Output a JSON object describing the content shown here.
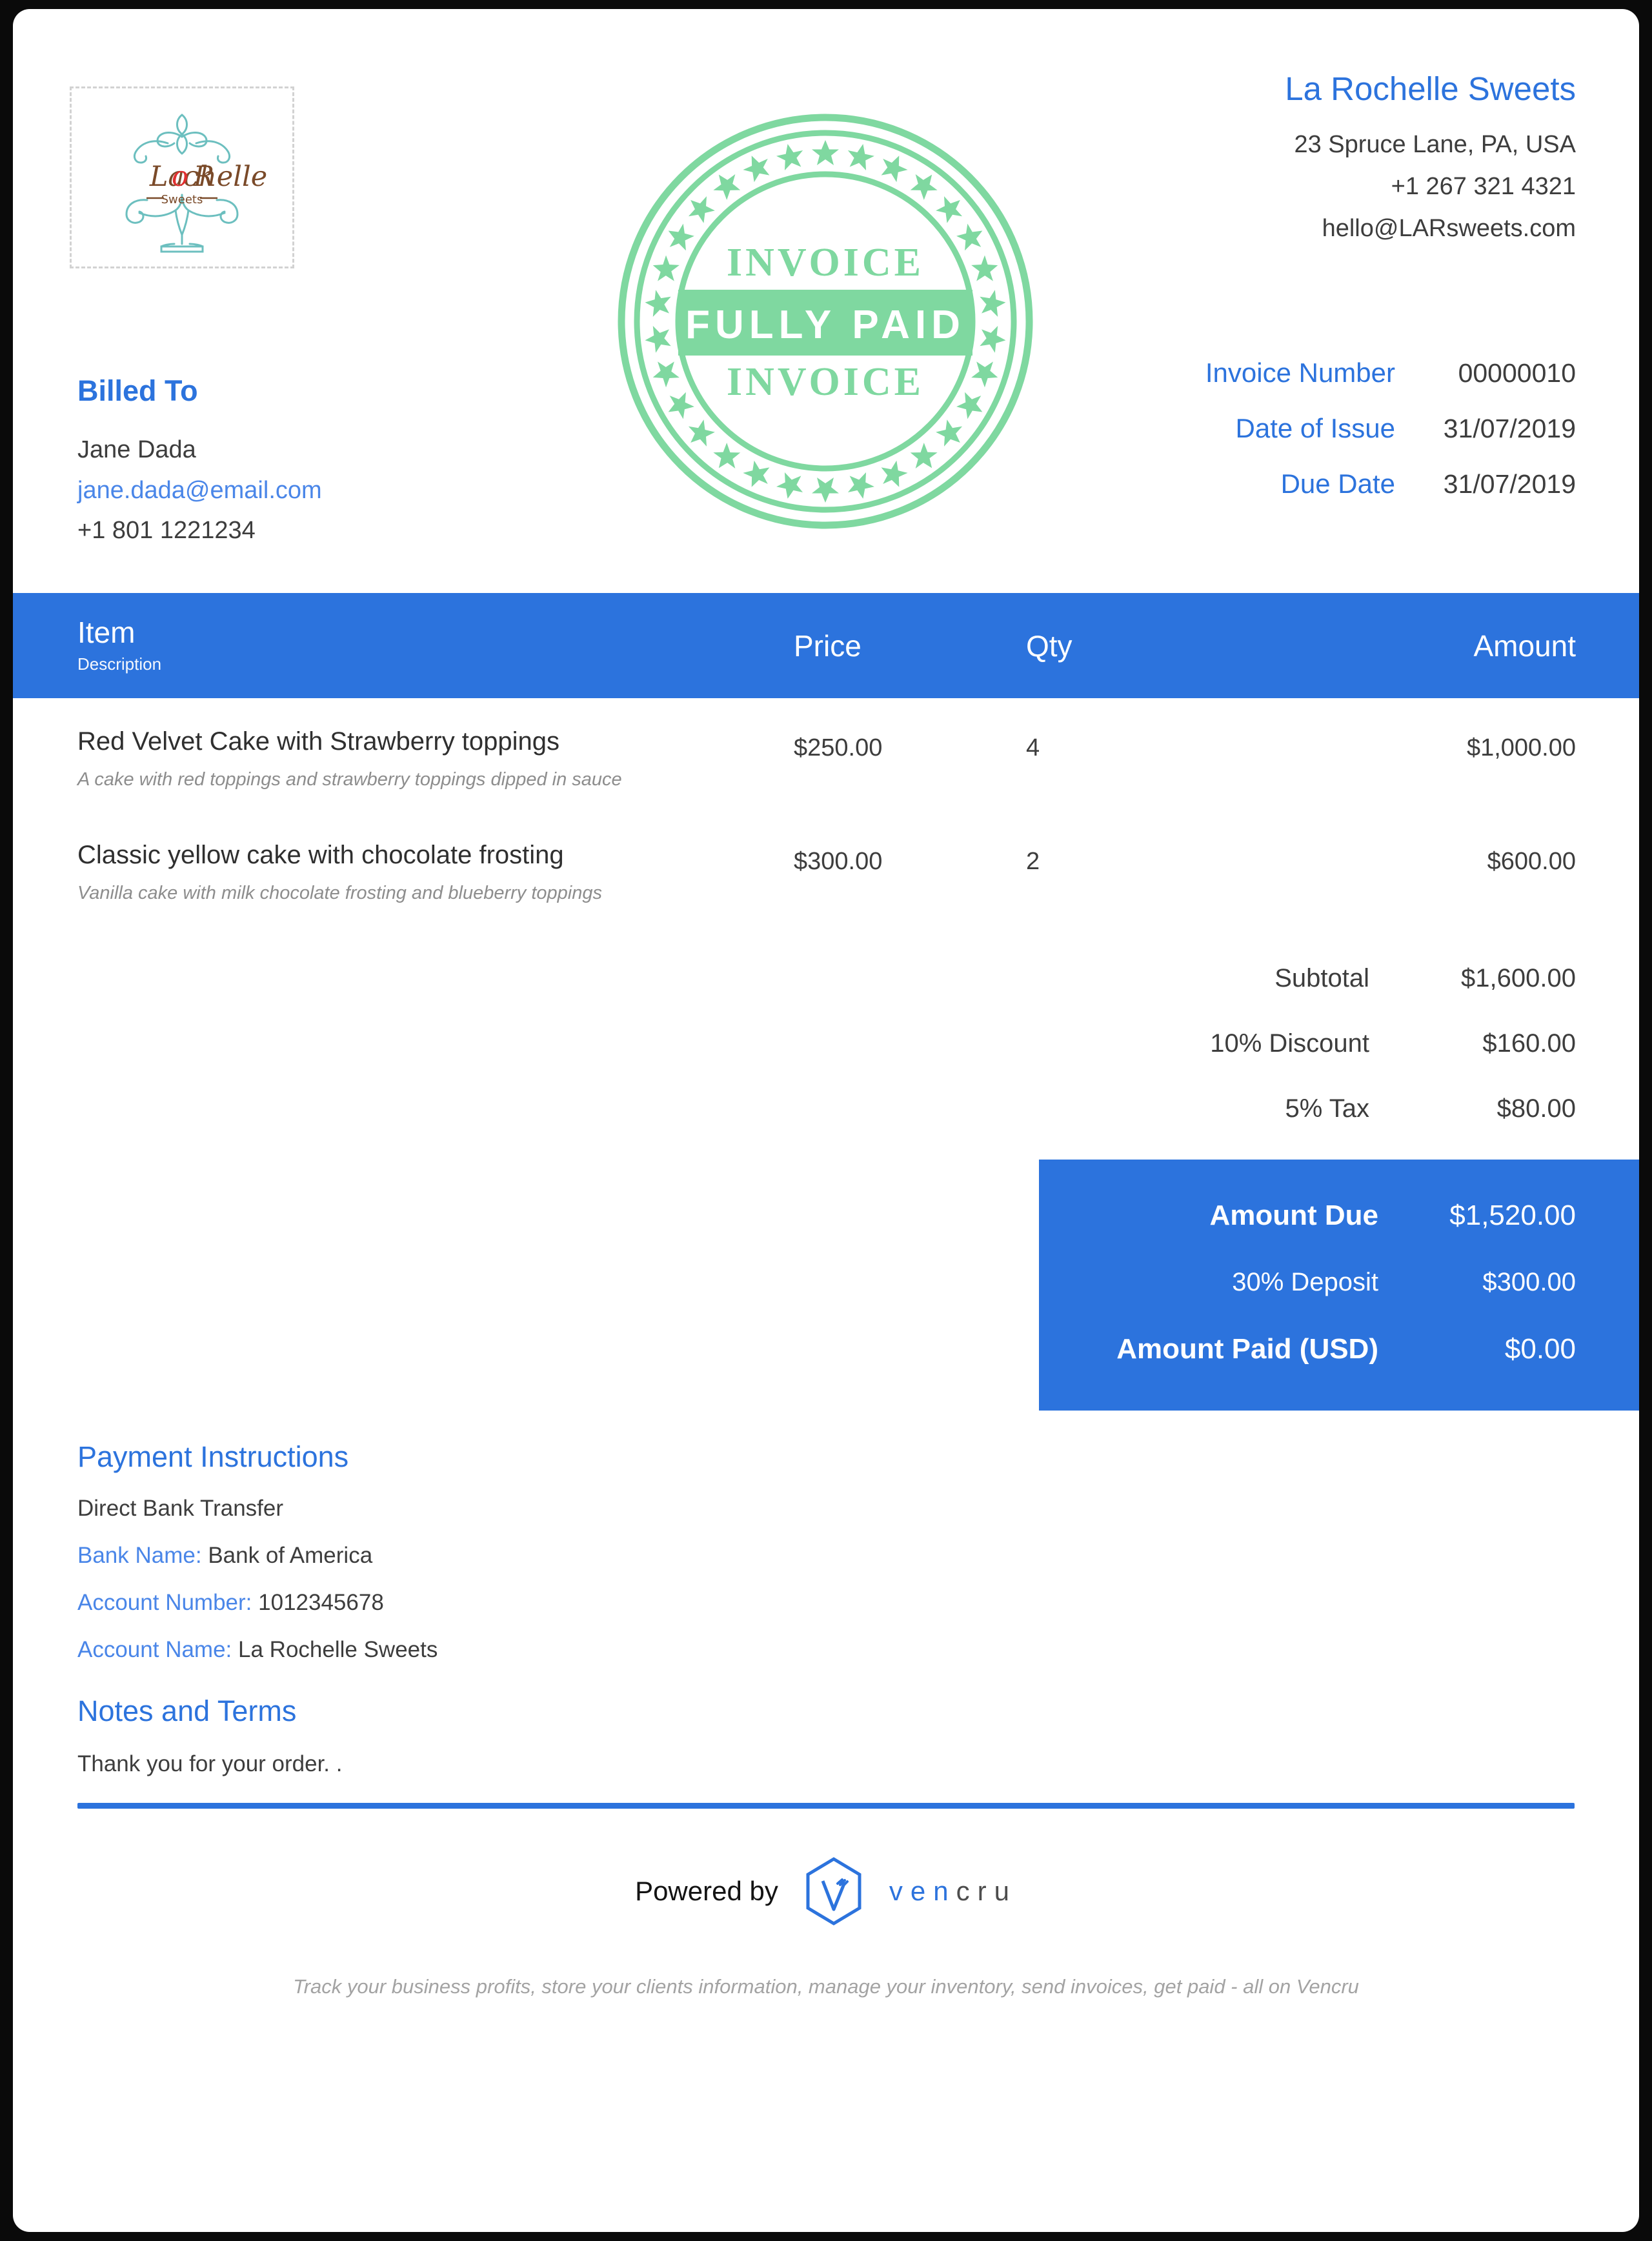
{
  "stamp": {
    "top_text": "INVOICE",
    "main_text": "FULLY PAID",
    "bottom_text": "INVOICE",
    "color": "#7fd8a0"
  },
  "logo": {
    "brand_script": "La Rochelle",
    "brand_sub": "Sweets"
  },
  "company": {
    "name": "La Rochelle Sweets",
    "address": "23 Spruce Lane, PA, USA",
    "phone": "+1 267 321 4321",
    "email": "hello@LARsweets.com"
  },
  "meta": {
    "rows": [
      {
        "label": "Invoice Number",
        "value": "00000010"
      },
      {
        "label": "Date of Issue",
        "value": "31/07/2019"
      },
      {
        "label": "Due Date",
        "value": "31/07/2019"
      }
    ]
  },
  "billed_to": {
    "title": "Billed To",
    "name": "Jane Dada",
    "email": "jane.dada@email.com",
    "phone": "+1 801 1221234"
  },
  "table": {
    "headers": {
      "item": "Item",
      "description": "Description",
      "price": "Price",
      "qty": "Qty",
      "amount": "Amount"
    },
    "rows": [
      {
        "name": "Red Velvet Cake with Strawberry toppings",
        "description": "A cake with red toppings and strawberry toppings dipped in sauce",
        "price": "$250.00",
        "qty": "4",
        "amount": "$1,000.00"
      },
      {
        "name": "Classic yellow cake with chocolate frosting",
        "description": "Vanilla cake with milk chocolate frosting and blueberry toppings",
        "price": "$300.00",
        "qty": "2",
        "amount": "$600.00"
      }
    ]
  },
  "totals": [
    {
      "label": "Subtotal",
      "value": "$1,600.00"
    },
    {
      "label": "10% Discount",
      "value": "$160.00"
    },
    {
      "label": "5% Tax",
      "value": "$80.00"
    }
  ],
  "due_box": {
    "amount_due_label": "Amount Due",
    "amount_due_value": "$1,520.00",
    "deposit_label": "30% Deposit",
    "deposit_value": "$300.00",
    "amount_paid_label": "Amount Paid (USD)",
    "amount_paid_value": "$0.00"
  },
  "payment": {
    "title": "Payment Instructions",
    "method": "Direct Bank Transfer",
    "bank_name_key": "Bank Name:",
    "bank_name_value": "Bank of America",
    "account_number_key": "Account Number:",
    "account_number_value": "1012345678",
    "account_name_key": "Account Name:",
    "account_name_value": "La Rochelle Sweets"
  },
  "notes": {
    "title": "Notes and Terms",
    "text": "Thank you for your order. ."
  },
  "footer": {
    "powered_by": "Powered by",
    "brand_part1": "ven",
    "brand_part2": "cru",
    "tagline": "Track your business profits, store your clients information, manage your inventory, send invoices, get paid - all on Vencru"
  },
  "colors": {
    "accent_blue": "#2c73dd",
    "link_blue": "#4a86e8",
    "stamp_green": "#7fd8a0",
    "text_dark": "#3d3d3d",
    "muted": "#8d8d8d"
  }
}
